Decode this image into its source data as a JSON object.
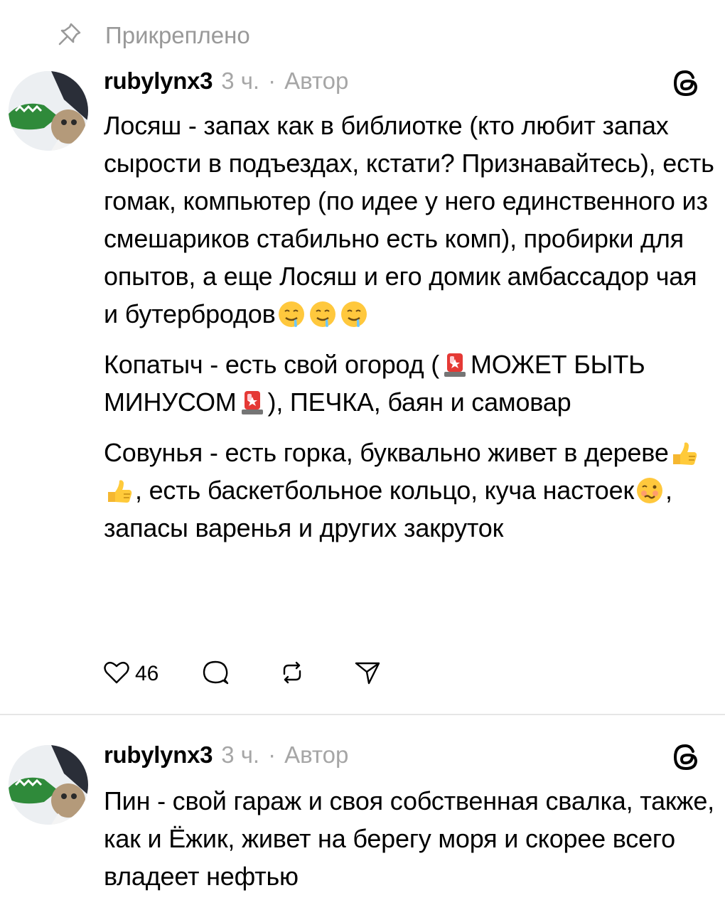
{
  "pinned": {
    "label": "Прикреплено",
    "icon": "pin-icon"
  },
  "posts": [
    {
      "username": "rubylynx3",
      "time": "3 ч.",
      "separator": "·",
      "role": "Автор",
      "paragraphs": [
        {
          "l1": "Лосяш - запах как в библиотке (кто любит запах сырости в подъездах, кстати? Признавайтесь), есть гомак, компьютер (по идее у него единственного из смешариков стабильно есть комп), пробирки для опытов, а еще Лосяш и его домик амбассадор чая и бутербродов"
        },
        {
          "l1": "Копатыч - есть свой огород (",
          "l2": "МОЖЕТ БЫТЬ МИНУСОМ",
          "l3": "), ПЕЧКА, баян и самовар"
        },
        {
          "l1": "Совунья - есть горка, буквально живет в дереве",
          "l2": ", есть баскетбольное кольцо, куча настоек",
          "l3": ", запасы варенья и других закруток"
        }
      ],
      "likes": "46"
    },
    {
      "username": "rubylynx3",
      "time": "3 ч.",
      "separator": "·",
      "role": "Автор",
      "paragraphs": [
        {
          "l1": "Пин - свой гараж и своя собственная свалка, также, как и Ёжик, живет на берегу моря и скорее всего владеет нефтью"
        }
      ]
    }
  ],
  "icons": {
    "drooling": "drooling-face-emoji",
    "siren": "police-light-emoji",
    "thumbs": "thumbs-up-emoji",
    "woozy": "woozy-face-emoji",
    "logo": "threads-logo-icon",
    "like": "heart-icon",
    "reply": "comment-icon",
    "repost": "repost-icon",
    "share": "send-icon"
  },
  "colors": {
    "muted": "#999999",
    "text": "#000000",
    "divider": "#e6e6e6"
  }
}
